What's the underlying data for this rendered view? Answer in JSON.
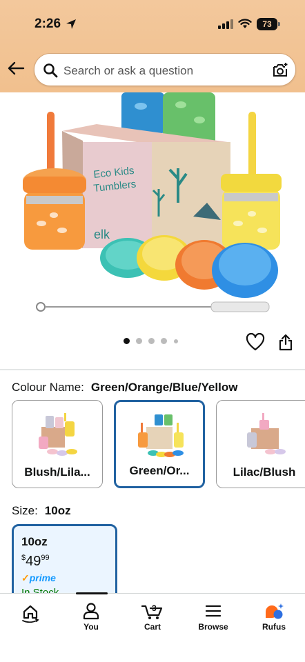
{
  "status_bar": {
    "time": "2:26",
    "battery": "73"
  },
  "search": {
    "placeholder": "Search or ask a question"
  },
  "product_image": {
    "box_title_line1": "Eco Kids",
    "box_title_line2": "Tumblers",
    "brand": "elk",
    "current_image": 1,
    "image_count": 5
  },
  "colour": {
    "label": "Colour Name:",
    "value": "Green/Orange/Blue/Yellow",
    "options": [
      {
        "label": "Blush/Lila..."
      },
      {
        "label": "Green/Or..."
      },
      {
        "label": "Lilac/Blush"
      }
    ]
  },
  "size": {
    "label": "Size:",
    "value": "10oz",
    "option": {
      "name": "10oz",
      "price_currency": "$",
      "price_whole": "49",
      "price_fraction": "99",
      "prime": "prime",
      "availability": "In Stock"
    }
  },
  "nav": {
    "items": [
      {
        "label": ""
      },
      {
        "label": "You"
      },
      {
        "label": "Cart",
        "badge": "3"
      },
      {
        "label": "Browse"
      },
      {
        "label": "Rufus"
      }
    ]
  },
  "colors": {
    "accent": "#2162a1",
    "header": "#f3c89c",
    "stock": "#007600",
    "prime": "#1399ff"
  }
}
